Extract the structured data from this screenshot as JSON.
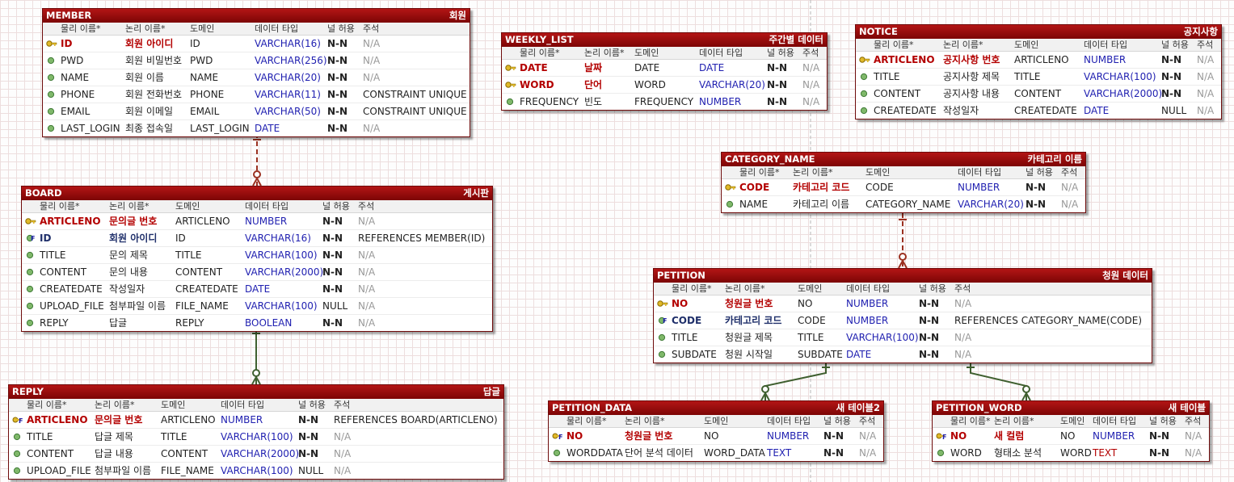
{
  "columns": [
    "물리 이름*",
    "논리 이름*",
    "도메인",
    "데이터 타입",
    "널 허용",
    "주석"
  ],
  "entities": [
    {
      "key": "member",
      "name": "MEMBER",
      "label": "회원",
      "rows": [
        {
          "kind": "pk",
          "phys": "ID",
          "logical": "회원 아이디",
          "domain": "ID",
          "type": "VARCHAR(16)",
          "nulls": "N-N",
          "comment": "N/A"
        },
        {
          "kind": "col",
          "phys": "PWD",
          "logical": "회원 비밀번호",
          "domain": "PWD",
          "type": "VARCHAR(256)",
          "nulls": "N-N",
          "comment": "N/A"
        },
        {
          "kind": "col",
          "phys": "NAME",
          "logical": "회원 이름",
          "domain": "NAME",
          "type": "VARCHAR(20)",
          "nulls": "N-N",
          "comment": "N/A"
        },
        {
          "kind": "col",
          "phys": "PHONE",
          "logical": "회원 전화번호",
          "domain": "PHONE",
          "type": "VARCHAR(11)",
          "nulls": "N-N",
          "comment": "CONSTRAINT UNIQUE"
        },
        {
          "kind": "col",
          "phys": "EMAIL",
          "logical": "회원 이메일",
          "domain": "EMAIL",
          "type": "VARCHAR(50)",
          "nulls": "N-N",
          "comment": "CONSTRAINT UNIQUE"
        },
        {
          "kind": "col",
          "phys": "LAST_LOGIN",
          "logical": "최종 접속일",
          "domain": "LAST_LOGIN",
          "type": "DATE",
          "nulls": "N-N",
          "comment": "N/A"
        }
      ]
    },
    {
      "key": "weekly",
      "name": "WEEKLY_LIST",
      "label": "주간별 데이터",
      "rows": [
        {
          "kind": "pk",
          "phys": "DATE",
          "logical": "날짜",
          "domain": "DATE",
          "type": "DATE",
          "nulls": "N-N",
          "comment": "N/A"
        },
        {
          "kind": "pk",
          "phys": "WORD",
          "logical": "단어",
          "domain": "WORD",
          "type": "VARCHAR(20)",
          "nulls": "N-N",
          "comment": "N/A"
        },
        {
          "kind": "col",
          "phys": "FREQUENCY",
          "logical": "빈도",
          "domain": "FREQUENCY",
          "type": "NUMBER",
          "nulls": "N-N",
          "comment": "N/A"
        }
      ]
    },
    {
      "key": "notice",
      "name": "NOTICE",
      "label": "공지사항",
      "rows": [
        {
          "kind": "pk",
          "phys": "ARTICLENO",
          "logical": "공지사항 번호",
          "domain": "ARTICLENO",
          "type": "NUMBER",
          "nulls": "N-N",
          "comment": "N/A"
        },
        {
          "kind": "col",
          "phys": "TITLE",
          "logical": "공지사항 제목",
          "domain": "TITLE",
          "type": "VARCHAR(100)",
          "nulls": "N-N",
          "comment": "N/A"
        },
        {
          "kind": "col",
          "phys": "CONTENT",
          "logical": "공지사항 내용",
          "domain": "CONTENT",
          "type": "VARCHAR(2000)",
          "nulls": "N-N",
          "comment": "N/A"
        },
        {
          "kind": "col",
          "phys": "CREATEDATE",
          "logical": "작성일자",
          "domain": "CREATEDATE",
          "type": "DATE",
          "nulls": "NULL",
          "comment": "N/A"
        }
      ]
    },
    {
      "key": "board",
      "name": "BOARD",
      "label": "게시판",
      "rows": [
        {
          "kind": "pk",
          "phys": "ARTICLENO",
          "logical": "문의글 번호",
          "domain": "ARTICLENO",
          "type": "NUMBER",
          "nulls": "N-N",
          "comment": "N/A"
        },
        {
          "kind": "fk",
          "phys": "ID",
          "logical": "회원 아이디",
          "domain": "ID",
          "type": "VARCHAR(16)",
          "nulls": "N-N",
          "comment": "REFERENCES MEMBER(ID)"
        },
        {
          "kind": "col",
          "phys": "TITLE",
          "logical": "문의 제목",
          "domain": "TITLE",
          "type": "VARCHAR(100)",
          "nulls": "N-N",
          "comment": "N/A"
        },
        {
          "kind": "col",
          "phys": "CONTENT",
          "logical": "문의 내용",
          "domain": "CONTENT",
          "type": "VARCHAR(2000)",
          "nulls": "N-N",
          "comment": "N/A"
        },
        {
          "kind": "col",
          "phys": "CREATEDATE",
          "logical": "작성일자",
          "domain": "CREATEDATE",
          "type": "DATE",
          "nulls": "N-N",
          "comment": "N/A"
        },
        {
          "kind": "col",
          "phys": "UPLOAD_FILE",
          "logical": "첨부파일 이름",
          "domain": "FILE_NAME",
          "type": "VARCHAR(100)",
          "nulls": "NULL",
          "comment": "N/A"
        },
        {
          "kind": "col",
          "phys": "REPLY",
          "logical": "답글",
          "domain": "REPLY",
          "type": "BOOLEAN",
          "nulls": "N-N",
          "comment": "N/A"
        }
      ]
    },
    {
      "key": "category",
      "name": "CATEGORY_NAME",
      "label": "카테고리 이름",
      "rows": [
        {
          "kind": "pk",
          "phys": "CODE",
          "logical": "카테고리 코드",
          "domain": "CODE",
          "type": "NUMBER",
          "nulls": "N-N",
          "comment": "N/A"
        },
        {
          "kind": "col",
          "phys": "NAME",
          "logical": "카테고리 이름",
          "domain": "CATEGORY_NAME",
          "type": "VARCHAR(20)",
          "nulls": "N-N",
          "comment": "N/A"
        }
      ]
    },
    {
      "key": "petition",
      "name": "PETITION",
      "label": "청원 데이터",
      "rows": [
        {
          "kind": "pk",
          "phys": "NO",
          "logical": "청원글 번호",
          "domain": "NO",
          "type": "NUMBER",
          "nulls": "N-N",
          "comment": "N/A"
        },
        {
          "kind": "fk",
          "phys": "CODE",
          "logical": "카테고리 코드",
          "domain": "CODE",
          "type": "NUMBER",
          "nulls": "N-N",
          "comment": "REFERENCES CATEGORY_NAME(CODE)"
        },
        {
          "kind": "col",
          "phys": "TITLE",
          "logical": "청원글 제목",
          "domain": "TITLE",
          "type": "VARCHAR(100)",
          "nulls": "N-N",
          "comment": "N/A"
        },
        {
          "kind": "col",
          "phys": "SUBDATE",
          "logical": "청원 시작일",
          "domain": "SUBDATE",
          "type": "DATE",
          "nulls": "N-N",
          "comment": "N/A"
        }
      ]
    },
    {
      "key": "reply",
      "name": "REPLY",
      "label": "답글",
      "rows": [
        {
          "kind": "pfk",
          "phys": "ARTICLENO",
          "logical": "문의글 번호",
          "domain": "ARTICLENO",
          "type": "NUMBER",
          "nulls": "N-N",
          "comment": "REFERENCES BOARD(ARTICLENO)"
        },
        {
          "kind": "col",
          "phys": "TITLE",
          "logical": "답글 제목",
          "domain": "TITLE",
          "type": "VARCHAR(100)",
          "nulls": "N-N",
          "comment": "N/A"
        },
        {
          "kind": "col",
          "phys": "CONTENT",
          "logical": "답글 내용",
          "domain": "CONTENT",
          "type": "VARCHAR(2000)",
          "nulls": "N-N",
          "comment": "N/A"
        },
        {
          "kind": "col",
          "phys": "UPLOAD_FILE",
          "logical": "첨부파일 이름",
          "domain": "FILE_NAME",
          "type": "VARCHAR(100)",
          "nulls": "NULL",
          "comment": "N/A"
        }
      ]
    },
    {
      "key": "pdata",
      "name": "PETITION_DATA",
      "label": "새 테이블2",
      "rows": [
        {
          "kind": "pfk",
          "phys": "NO",
          "logical": "청원글 번호",
          "domain": "NO",
          "type": "NUMBER",
          "nulls": "N-N",
          "comment": "N/A"
        },
        {
          "kind": "col",
          "phys": "WORDDATA",
          "logical": "단어 분석 데이터",
          "domain": "WORD_DATA",
          "type": "TEXT",
          "nulls": "N-N",
          "comment": "N/A"
        }
      ]
    },
    {
      "key": "pword",
      "name": "PETITION_WORD",
      "label": "새 테이블",
      "rows": [
        {
          "kind": "pfk",
          "phys": "NO",
          "logical": "새 컬럼",
          "domain": "NO",
          "type": "NUMBER",
          "nulls": "N-N",
          "comment": "N/A"
        },
        {
          "kind": "col",
          "phys": "WORD",
          "logical": "형태소 분석",
          "domain": "WORD",
          "type": "TEXT",
          "nulls": "N-N",
          "comment": "N/A",
          "type_color": "#b30000"
        }
      ]
    }
  ],
  "colors": {
    "header": "#9b0f0f",
    "key_text": "#b30000",
    "datatype": "#1f1fb0",
    "relation_identifying": "#9b3020",
    "relation_non_identifying": "#3f5f2f"
  }
}
